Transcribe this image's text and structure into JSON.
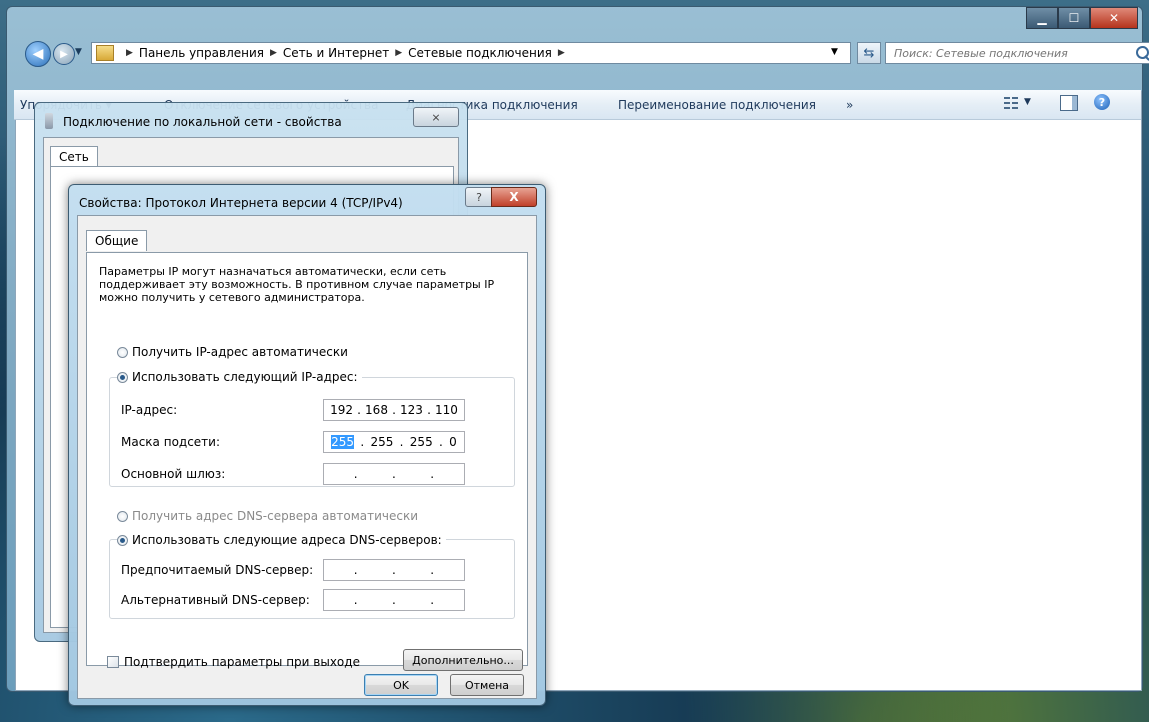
{
  "explorer": {
    "breadcrumb": [
      "Панель управления",
      "Сеть и Интернет",
      "Сетевые подключения"
    ],
    "search_placeholder": "Поиск: Сетевые подключения",
    "toolbar": {
      "organize": "Упорядочить ▾",
      "disable_device": "Отключение сетевого устройства",
      "diagnose": "Диагностика подключения",
      "rename": "Переименование подключения",
      "more": "»"
    },
    "caption": {
      "minimize": "▁",
      "maximize": "☐",
      "close": "✕"
    }
  },
  "connection_dialog": {
    "title": "Подключение по локальной сети - свойства",
    "tab": "Сеть",
    "close": "⨯"
  },
  "ipv4_dialog": {
    "title": "Свойства: Протокол Интернета версии 4 (TCP/IPv4)",
    "help": "?",
    "close": "X",
    "tab": "Общие",
    "intro": "Параметры IP могут назначаться автоматически, если сеть поддерживает эту возможность. В противном случае параметры IP можно получить у сетевого администратора.",
    "ip_auto": "Получить IP-адрес автоматически",
    "ip_manual": "Использовать следующий IP-адрес:",
    "ip_label": "IP-адрес:",
    "ip_value": [
      "192",
      "168",
      "123",
      "110"
    ],
    "mask_label": "Маска подсети:",
    "mask_value": [
      "255",
      "255",
      "255",
      "0"
    ],
    "gateway_label": "Основной шлюз:",
    "gateway_value": [
      "",
      "",
      "",
      ""
    ],
    "dns_auto": "Получить адрес DNS-сервера автоматически",
    "dns_manual": "Использовать следующие адреса DNS-серверов:",
    "dns_pref_label": "Предпочитаемый DNS-сервер:",
    "dns_pref_value": [
      "",
      "",
      "",
      ""
    ],
    "dns_alt_label": "Альтернативный DNS-сервер:",
    "dns_alt_value": [
      "",
      "",
      "",
      ""
    ],
    "confirm": "Подтвердить параметры при выходе",
    "advanced": "Дополнительно...",
    "ok": "OK",
    "cancel": "Отмена"
  }
}
